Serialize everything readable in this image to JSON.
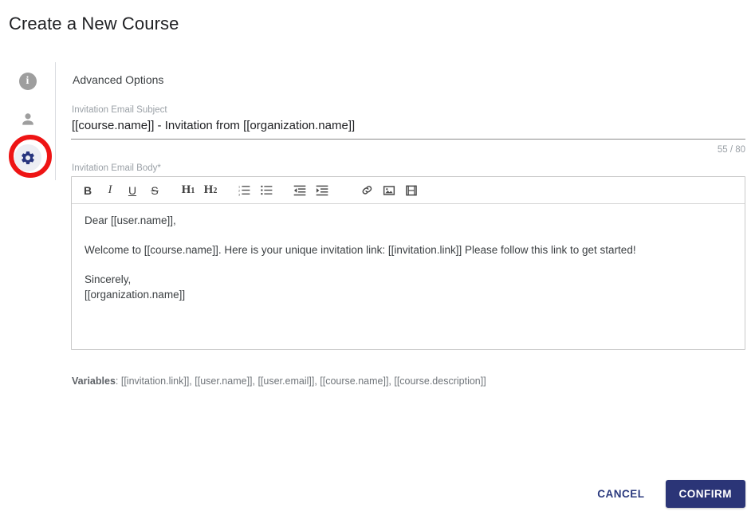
{
  "dialog": {
    "title": "Create a New Course"
  },
  "sidebar": {
    "items": [
      {
        "name": "info",
        "icon": "info-circle-icon",
        "glyph": "i"
      },
      {
        "name": "user",
        "icon": "person-icon"
      },
      {
        "name": "settings",
        "icon": "gear-icon",
        "selected": true,
        "highlight_color": "#ee1414"
      }
    ]
  },
  "main": {
    "section_heading": "Advanced Options",
    "subject_field": {
      "label": "Invitation Email Subject",
      "value": "[[course.name]] - Invitation from [[organization.name]]",
      "placeholder": ""
    },
    "char_counter": "55 / 80",
    "body_field": {
      "label": "Invitation Email Body*",
      "paragraphs": [
        "Dear [[user.name]],",
        "Welcome to [[course.name]]. Here is your unique invitation link: [[invitation.link]] Please follow this link to get started!",
        "Sincerely,",
        "[[organization.name]]"
      ]
    },
    "toolbar": {
      "buttons": [
        {
          "name": "bold",
          "icon": "bold-icon",
          "label": "B"
        },
        {
          "name": "italic",
          "icon": "italic-icon",
          "label": "I"
        },
        {
          "name": "underline",
          "icon": "underline-icon",
          "label": "U"
        },
        {
          "name": "strikethrough",
          "icon": "strikethrough-icon",
          "label": "S"
        },
        {
          "name": "heading-1",
          "icon": "heading-1-icon",
          "label": "H",
          "sub": "1"
        },
        {
          "name": "heading-2",
          "icon": "heading-2-icon",
          "label": "H",
          "sub": "2"
        },
        {
          "name": "ordered-list",
          "icon": "ordered-list-icon"
        },
        {
          "name": "unordered-list",
          "icon": "unordered-list-icon"
        },
        {
          "name": "outdent",
          "icon": "outdent-icon"
        },
        {
          "name": "indent",
          "icon": "indent-icon"
        },
        {
          "name": "link",
          "icon": "link-icon"
        },
        {
          "name": "image",
          "icon": "image-icon"
        },
        {
          "name": "video",
          "icon": "video-icon"
        }
      ]
    },
    "variables": {
      "label": "Variables",
      "value": ": [[invitation.link]], [[user.name]], [[user.email]], [[course.name]], [[course.description]]"
    }
  },
  "footer": {
    "cancel_label": "CANCEL",
    "confirm_label": "CONFIRM",
    "confirm_color": "#2b3577"
  }
}
